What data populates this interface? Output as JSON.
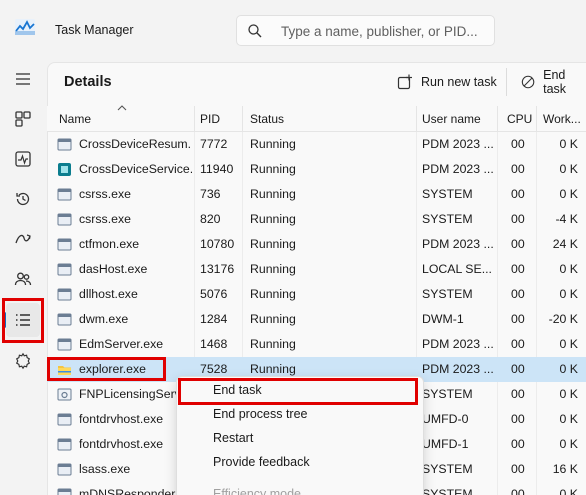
{
  "window": {
    "title": "Task Manager",
    "search_placeholder": "Type a name, publisher, or PID..."
  },
  "sidebar": {
    "items": [
      {
        "icon": "hamburger-menu-icon"
      },
      {
        "icon": "processes-icon"
      },
      {
        "icon": "performance-icon"
      },
      {
        "icon": "app-history-icon"
      },
      {
        "icon": "startup-apps-icon"
      },
      {
        "icon": "users-icon"
      },
      {
        "icon": "details-icon",
        "selected": true
      },
      {
        "icon": "services-icon"
      }
    ]
  },
  "page": {
    "title": "Details",
    "run_new_task": "Run new task",
    "end_task": "End task"
  },
  "columns": {
    "name": "Name",
    "pid": "PID",
    "status": "Status",
    "user": "User name",
    "cpu": "CPU",
    "work": "Work..."
  },
  "rows": [
    {
      "name": "CrossDeviceResum...",
      "pid": "7772",
      "status": "Running",
      "user": "PDM 2023 ...",
      "cpu": "00",
      "work": "0 K",
      "icon": "app-default-icon"
    },
    {
      "name": "CrossDeviceService...",
      "pid": "11940",
      "status": "Running",
      "user": "PDM 2023 ...",
      "cpu": "00",
      "work": "0 K",
      "icon": "app-teal-icon"
    },
    {
      "name": "csrss.exe",
      "pid": "736",
      "status": "Running",
      "user": "SYSTEM",
      "cpu": "00",
      "work": "0 K",
      "icon": "app-default-icon"
    },
    {
      "name": "csrss.exe",
      "pid": "820",
      "status": "Running",
      "user": "SYSTEM",
      "cpu": "00",
      "work": "-4 K",
      "icon": "app-default-icon"
    },
    {
      "name": "ctfmon.exe",
      "pid": "10780",
      "status": "Running",
      "user": "PDM 2023 ...",
      "cpu": "00",
      "work": "24 K",
      "icon": "app-default-icon"
    },
    {
      "name": "dasHost.exe",
      "pid": "13176",
      "status": "Running",
      "user": "LOCAL SE...",
      "cpu": "00",
      "work": "0 K",
      "icon": "app-default-icon"
    },
    {
      "name": "dllhost.exe",
      "pid": "5076",
      "status": "Running",
      "user": "SYSTEM",
      "cpu": "00",
      "work": "0 K",
      "icon": "app-default-icon"
    },
    {
      "name": "dwm.exe",
      "pid": "1284",
      "status": "Running",
      "user": "DWM-1",
      "cpu": "00",
      "work": "-20 K",
      "icon": "app-default-icon"
    },
    {
      "name": "EdmServer.exe",
      "pid": "1468",
      "status": "Running",
      "user": "PDM 2023 ...",
      "cpu": "00",
      "work": "0 K",
      "icon": "app-default-icon"
    },
    {
      "name": "explorer.exe",
      "pid": "7528",
      "status": "Running",
      "user": "PDM 2023 ...",
      "cpu": "00",
      "work": "0 K",
      "icon": "folder-icon",
      "selected": true
    },
    {
      "name": "FNPLicensingServi...",
      "pid": "",
      "status": "",
      "user": "SYSTEM",
      "cpu": "00",
      "work": "0 K",
      "icon": "service-icon"
    },
    {
      "name": "fontdrvhost.exe",
      "pid": "",
      "status": "",
      "user": "UMFD-0",
      "cpu": "00",
      "work": "0 K",
      "icon": "app-default-icon"
    },
    {
      "name": "fontdrvhost.exe",
      "pid": "",
      "status": "",
      "user": "UMFD-1",
      "cpu": "00",
      "work": "0 K",
      "icon": "app-default-icon"
    },
    {
      "name": "lsass.exe",
      "pid": "",
      "status": "",
      "user": "SYSTEM",
      "cpu": "00",
      "work": "16 K",
      "icon": "app-default-icon"
    },
    {
      "name": "mDNSResponder.e...",
      "pid": "",
      "status": "",
      "user": "SYSTEM",
      "cpu": "00",
      "work": "0 K",
      "icon": "app-default-icon"
    }
  ],
  "context_menu": {
    "items": [
      {
        "label": "End task",
        "highlighted": true
      },
      {
        "label": "End process tree"
      },
      {
        "label": "Restart"
      },
      {
        "label": "Provide feedback"
      },
      {
        "label": "Efficiency mode",
        "disabled": true
      }
    ]
  },
  "colors": {
    "accent": "#0f6cbd",
    "selection": "#cce4f7",
    "annotation_red": "#e00000"
  }
}
